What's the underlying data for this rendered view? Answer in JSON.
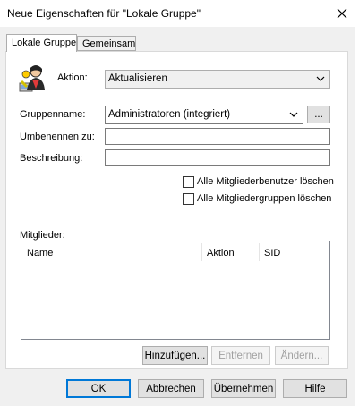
{
  "window": {
    "title": "Neue Eigenschaften für \"Lokale Gruppe\"",
    "close_icon": "close-icon"
  },
  "tabs": [
    {
      "label": "Lokale Gruppe",
      "active": true
    },
    {
      "label": "Gemeinsam",
      "active": false
    }
  ],
  "action": {
    "label": "Aktion:",
    "value": "Aktualisieren",
    "icon": "local-group-users-icon"
  },
  "group": {
    "name_label": "Gruppenname:",
    "name_value": "Administratoren (integriert)",
    "browse_label": "...",
    "rename_label": "Umbenennen zu:",
    "rename_value": "",
    "description_label": "Beschreibung:",
    "description_value": ""
  },
  "options": {
    "delete_users_label": "Alle Mitgliederbenutzer löschen",
    "delete_users_checked": false,
    "delete_groups_label": "Alle Mitgliedergruppen löschen",
    "delete_groups_checked": false
  },
  "members": {
    "label": "Mitglieder:",
    "columns": [
      "Name",
      "Aktion",
      "SID"
    ],
    "rows": []
  },
  "member_buttons": {
    "add": "Hinzufügen...",
    "remove": "Entfernen",
    "change": "Ändern..."
  },
  "footer": {
    "ok": "OK",
    "cancel": "Abbrechen",
    "apply": "Übernehmen",
    "help": "Hilfe"
  }
}
